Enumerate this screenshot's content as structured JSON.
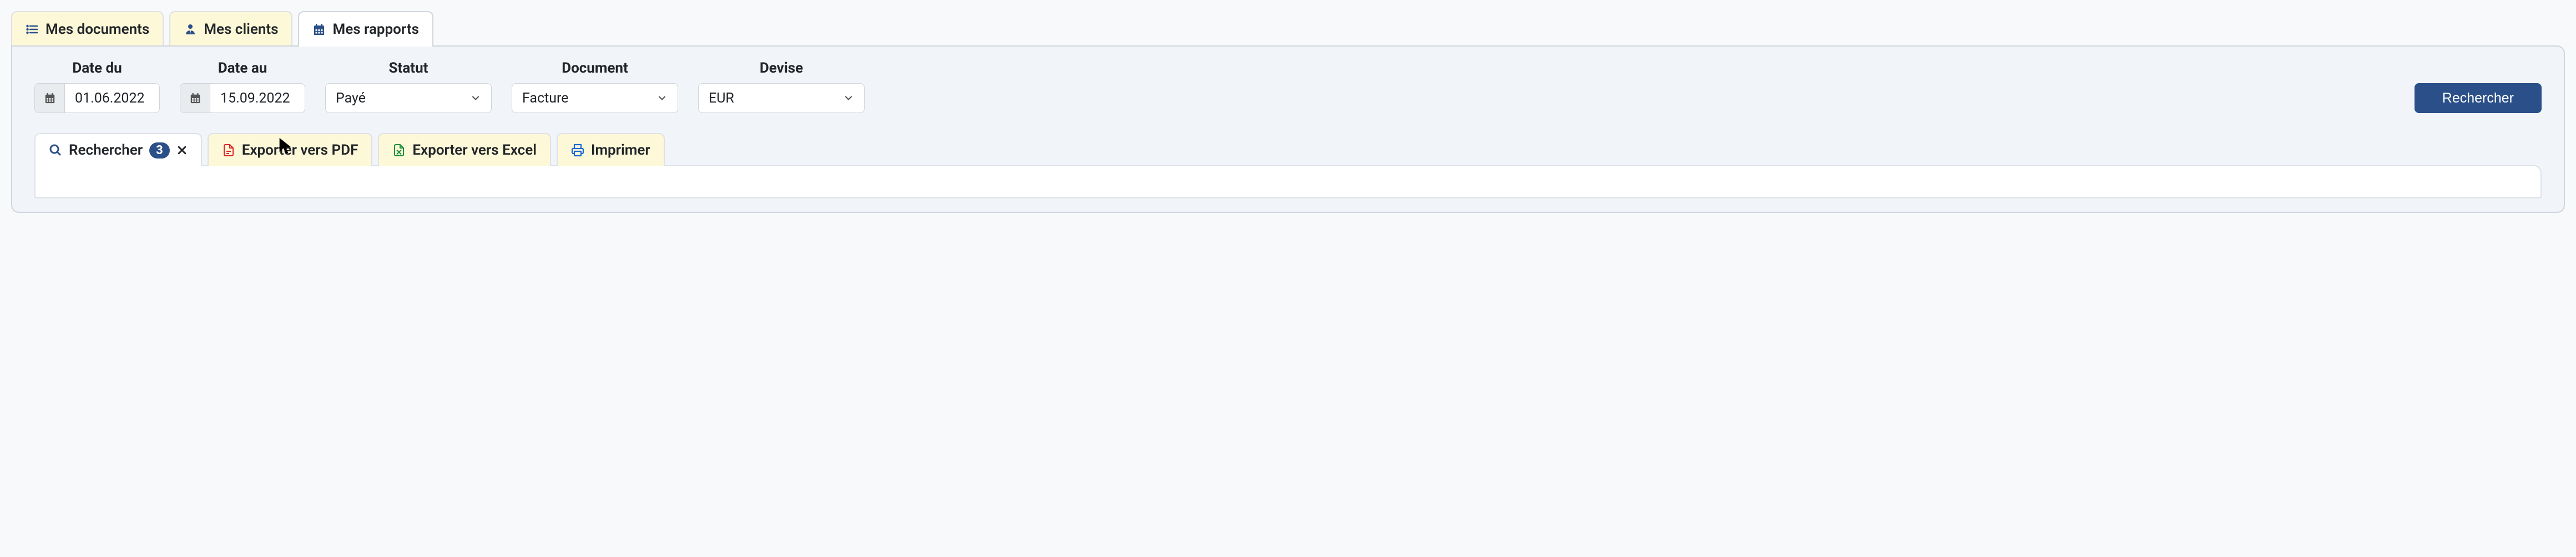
{
  "tabs": {
    "documents": "Mes documents",
    "clients": "Mes clients",
    "reports": "Mes rapports"
  },
  "filters": {
    "date_from": {
      "label": "Date du",
      "value": "01.06.2022"
    },
    "date_to": {
      "label": "Date au",
      "value": "15.09.2022"
    },
    "status": {
      "label": "Statut",
      "value": "Payé"
    },
    "document": {
      "label": "Document",
      "value": "Facture"
    },
    "currency": {
      "label": "Devise",
      "value": "EUR"
    },
    "search_button": "Rechercher"
  },
  "sub_tabs": {
    "search": {
      "label": "Rechercher",
      "count": "3"
    },
    "export_pdf": "Exporter vers PDF",
    "export_excel": "Exporter vers Excel",
    "print": "Imprimer"
  }
}
